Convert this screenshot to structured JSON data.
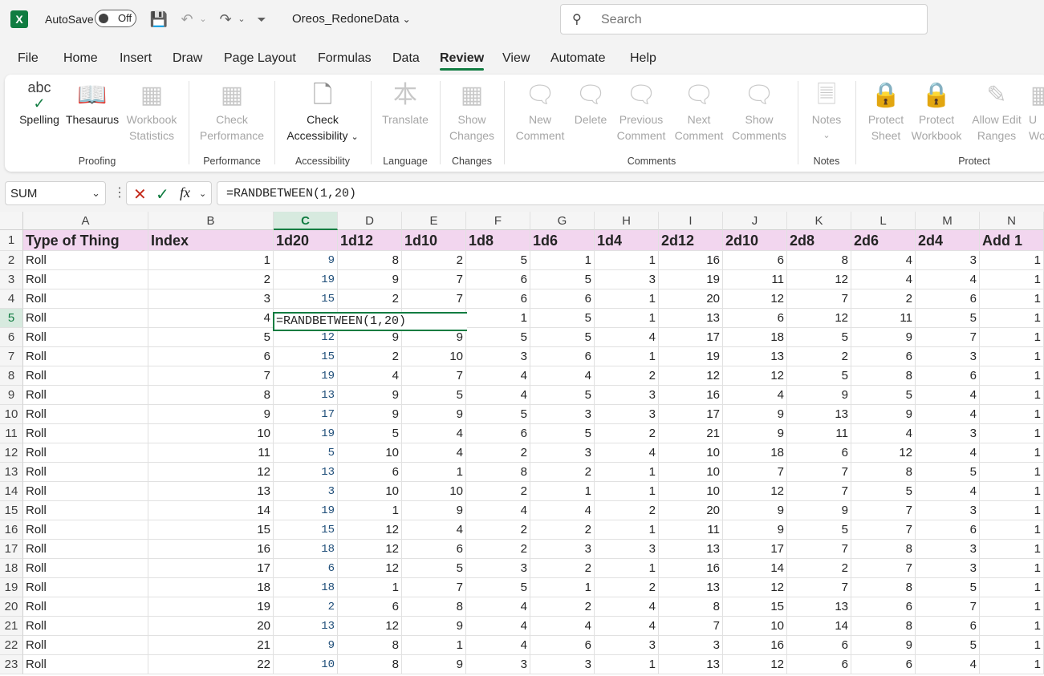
{
  "titlebar": {
    "autosave_label": "AutoSave",
    "autosave_state": "Off",
    "file_name": "Oreos_RedoneData",
    "search_placeholder": "Search"
  },
  "tabs": [
    "File",
    "Home",
    "Insert",
    "Draw",
    "Page Layout",
    "Formulas",
    "Data",
    "Review",
    "View",
    "Automate",
    "Help"
  ],
  "active_tab": "Review",
  "ribbon": {
    "buttons": {
      "spelling": "Spelling",
      "thesaurus": "Thesaurus",
      "workbook_statistics": [
        "Workbook",
        "Statistics"
      ],
      "check_performance": [
        "Check",
        "Performance"
      ],
      "check_accessibility": [
        "Check",
        "Accessibility"
      ],
      "translate": "Translate",
      "show_changes": [
        "Show",
        "Changes"
      ],
      "new_comment": [
        "New",
        "Comment"
      ],
      "delete": "Delete",
      "previous_comment": [
        "Previous",
        "Comment"
      ],
      "next_comment": [
        "Next",
        "Comment"
      ],
      "show_comments": [
        "Show",
        "Comments"
      ],
      "notes": "Notes",
      "protect_sheet": [
        "Protect",
        "Sheet"
      ],
      "protect_workbook": [
        "Protect",
        "Workbook"
      ],
      "allow_edit_ranges": [
        "Allow Edit",
        "Ranges"
      ],
      "unshare": [
        "U",
        "Wo"
      ]
    },
    "groups": {
      "proofing": "Proofing",
      "performance": "Performance",
      "accessibility": "Accessibility",
      "language": "Language",
      "changes": "Changes",
      "comments": "Comments",
      "notes": "Notes",
      "protect": "Protect"
    }
  },
  "formula_bar": {
    "name_box": "SUM",
    "fx": "fx",
    "formula": "=RANDBETWEEN(1,20)"
  },
  "grid": {
    "columns": [
      "A",
      "B",
      "C",
      "D",
      "E",
      "F",
      "G",
      "H",
      "I",
      "J",
      "K",
      "L",
      "M",
      "N"
    ],
    "selected_column": "C",
    "selected_row": "5",
    "header_row": [
      "Type of Thing",
      "Index",
      "1d20",
      "1d12",
      "1d10",
      "1d8",
      "1d6",
      "1d4",
      "2d12",
      "2d10",
      "2d8",
      "2d6",
      "2d4",
      "Add 1"
    ],
    "editing_text": "=RANDBETWEEN(1,20)",
    "rows": [
      [
        "Roll",
        "1",
        "9",
        "8",
        "2",
        "5",
        "1",
        "1",
        "16",
        "6",
        "8",
        "4",
        "3",
        "1"
      ],
      [
        "Roll",
        "2",
        "19",
        "9",
        "7",
        "6",
        "5",
        "3",
        "19",
        "11",
        "12",
        "4",
        "4",
        "1"
      ],
      [
        "Roll",
        "3",
        "15",
        "2",
        "7",
        "6",
        "6",
        "1",
        "20",
        "12",
        "7",
        "2",
        "6",
        "1"
      ],
      [
        "Roll",
        "4",
        "",
        "",
        "",
        "1",
        "5",
        "1",
        "13",
        "6",
        "12",
        "11",
        "5",
        "1"
      ],
      [
        "Roll",
        "5",
        "12",
        "9",
        "9",
        "5",
        "5",
        "4",
        "17",
        "18",
        "5",
        "9",
        "7",
        "1"
      ],
      [
        "Roll",
        "6",
        "15",
        "2",
        "10",
        "3",
        "6",
        "1",
        "19",
        "13",
        "2",
        "6",
        "3",
        "1"
      ],
      [
        "Roll",
        "7",
        "19",
        "4",
        "7",
        "4",
        "4",
        "2",
        "12",
        "12",
        "5",
        "8",
        "6",
        "1"
      ],
      [
        "Roll",
        "8",
        "13",
        "9",
        "5",
        "4",
        "5",
        "3",
        "16",
        "4",
        "9",
        "5",
        "4",
        "1"
      ],
      [
        "Roll",
        "9",
        "17",
        "9",
        "9",
        "5",
        "3",
        "3",
        "17",
        "9",
        "13",
        "9",
        "4",
        "1"
      ],
      [
        "Roll",
        "10",
        "19",
        "5",
        "4",
        "6",
        "5",
        "2",
        "21",
        "9",
        "11",
        "4",
        "3",
        "1"
      ],
      [
        "Roll",
        "11",
        "5",
        "10",
        "4",
        "2",
        "3",
        "4",
        "10",
        "18",
        "6",
        "12",
        "4",
        "1"
      ],
      [
        "Roll",
        "12",
        "13",
        "6",
        "1",
        "8",
        "2",
        "1",
        "10",
        "7",
        "7",
        "8",
        "5",
        "1"
      ],
      [
        "Roll",
        "13",
        "3",
        "10",
        "10",
        "2",
        "1",
        "1",
        "10",
        "12",
        "7",
        "5",
        "4",
        "1"
      ],
      [
        "Roll",
        "14",
        "19",
        "1",
        "9",
        "4",
        "4",
        "2",
        "20",
        "9",
        "9",
        "7",
        "3",
        "1"
      ],
      [
        "Roll",
        "15",
        "15",
        "12",
        "4",
        "2",
        "2",
        "1",
        "11",
        "9",
        "5",
        "7",
        "6",
        "1"
      ],
      [
        "Roll",
        "16",
        "18",
        "12",
        "6",
        "2",
        "3",
        "3",
        "13",
        "17",
        "7",
        "8",
        "3",
        "1"
      ],
      [
        "Roll",
        "17",
        "6",
        "12",
        "5",
        "3",
        "2",
        "1",
        "16",
        "14",
        "2",
        "7",
        "3",
        "1"
      ],
      [
        "Roll",
        "18",
        "18",
        "1",
        "7",
        "5",
        "1",
        "2",
        "13",
        "12",
        "7",
        "8",
        "5",
        "1"
      ],
      [
        "Roll",
        "19",
        "2",
        "6",
        "8",
        "4",
        "2",
        "4",
        "8",
        "15",
        "13",
        "6",
        "7",
        "1"
      ],
      [
        "Roll",
        "20",
        "13",
        "12",
        "9",
        "4",
        "4",
        "4",
        "7",
        "10",
        "14",
        "8",
        "6",
        "1"
      ],
      [
        "Roll",
        "21",
        "9",
        "8",
        "1",
        "4",
        "6",
        "3",
        "3",
        "16",
        "6",
        "9",
        "5",
        "1"
      ],
      [
        "Roll",
        "22",
        "10",
        "8",
        "9",
        "3",
        "3",
        "1",
        "13",
        "12",
        "6",
        "6",
        "4",
        "1"
      ]
    ]
  }
}
